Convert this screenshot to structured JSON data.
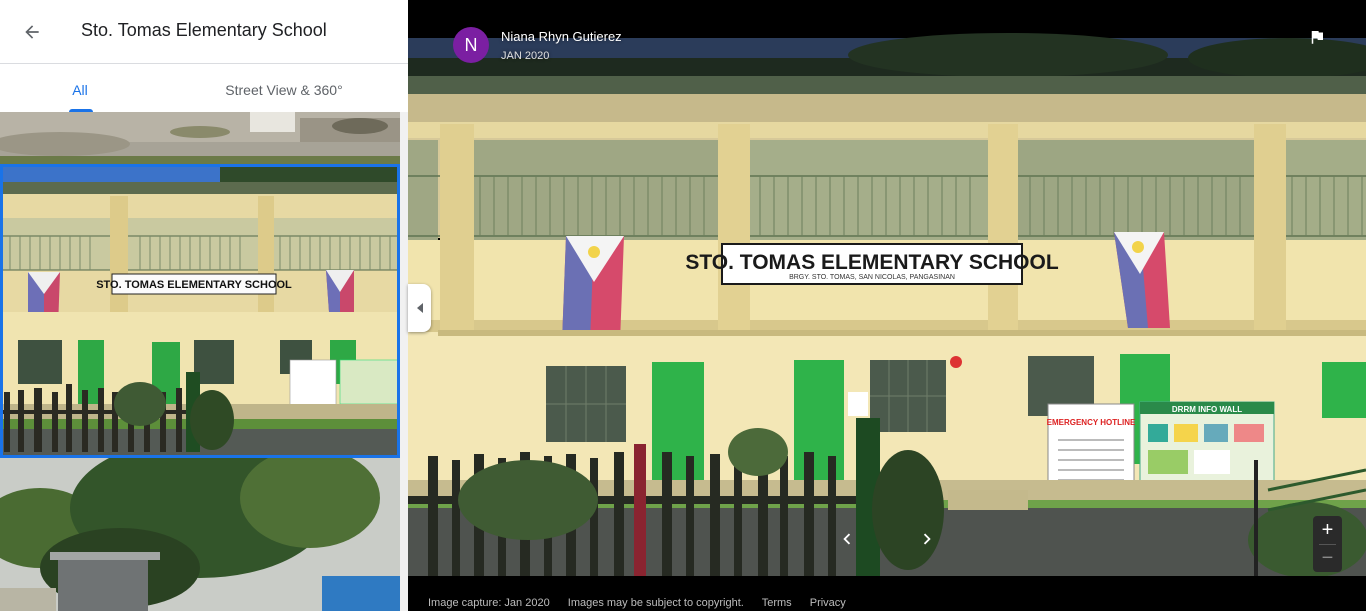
{
  "place": {
    "title": "Sto. Tomas Elementary School"
  },
  "tabs": [
    {
      "label": "All",
      "active": true
    },
    {
      "label": "Street View & 360°",
      "active": false
    }
  ],
  "contributor": {
    "initial": "N",
    "name": "Niana Rhyn Gutierez",
    "date": "JAN 2020",
    "avatar_color": "#7b1fa2"
  },
  "signage": {
    "school_sign": "STO. TOMAS ELEMENTARY SCHOOL",
    "school_sign_sub": "BRGY. STO. TOMAS, SAN NICOLAS, PANGASINAN",
    "emergency_board": "EMERGENCY HOTLINE",
    "info_board": "DRRM INFO WALL"
  },
  "zoom": {
    "in": "+",
    "out": "−"
  },
  "footer": {
    "capture": "Image capture: Jan 2020",
    "copyright": "Images may be subject to copyright.",
    "terms": "Terms",
    "privacy": "Privacy"
  },
  "colors": {
    "accent": "#1a73e8",
    "wall": "#f3e7b6",
    "door_green": "#2eb84a"
  },
  "icons": {
    "back": "arrow-left-icon",
    "flag": "flag-icon",
    "prev": "chevron-left-icon",
    "next": "chevron-right-icon",
    "collapse": "triangle-left-icon"
  }
}
